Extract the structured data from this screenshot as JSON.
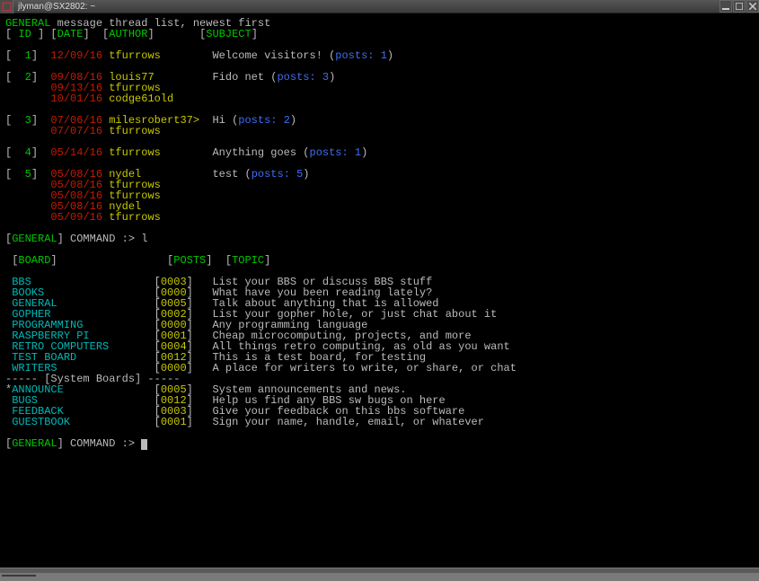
{
  "window": {
    "title": "jlyman@SX2802: ~"
  },
  "header": {
    "board": "GENERAL",
    "desc": "message thread list, newest first",
    "cols": {
      "id": "ID",
      "date": "DATE",
      "author": "AUTHOR",
      "subject": "SUBJECT"
    }
  },
  "threads": [
    {
      "id": "1",
      "rows": [
        {
          "date": "12/09/16",
          "author": "tfurrows"
        }
      ],
      "subject_pre": "Welcome visitors! (",
      "posts_label": "posts: 1",
      "subject_post": ")"
    },
    {
      "id": "2",
      "rows": [
        {
          "date": "09/08/16",
          "author": "louis77"
        },
        {
          "date": "09/13/16",
          "author": "tfurrows"
        },
        {
          "date": "10/01/16",
          "author": "codge61old"
        }
      ],
      "subject_pre": "Fido net (",
      "posts_label": "posts: 3",
      "subject_post": ")"
    },
    {
      "id": "3",
      "rows": [
        {
          "date": "07/06/16",
          "author": "milesrobert37>"
        },
        {
          "date": "07/07/16",
          "author": "tfurrows"
        }
      ],
      "subject_pre": "Hi (",
      "posts_label": "posts: 2",
      "subject_post": ")"
    },
    {
      "id": "4",
      "rows": [
        {
          "date": "05/14/16",
          "author": "tfurrows"
        }
      ],
      "subject_pre": "Anything goes (",
      "posts_label": "posts: 1",
      "subject_post": ")"
    },
    {
      "id": "5",
      "rows": [
        {
          "date": "05/08/16",
          "author": "nydel"
        },
        {
          "date": "05/08/16",
          "author": "tfurrows"
        },
        {
          "date": "05/08/16",
          "author": "tfurrows"
        },
        {
          "date": "05/08/16",
          "author": "nydel"
        },
        {
          "date": "05/09/16",
          "author": "tfurrows"
        }
      ],
      "subject_pre": "test (",
      "posts_label": "posts: 5",
      "subject_post": ")"
    }
  ],
  "prompt": {
    "board": "GENERAL",
    "label": "COMMAND :>",
    "entered": "l"
  },
  "board_hdr": {
    "board": "BOARD",
    "posts": "POSTS",
    "topic": "TOPIC"
  },
  "boards": [
    {
      "name": "BBS",
      "posts": "0003",
      "topic": "List your BBS or discuss BBS stuff",
      "star": false
    },
    {
      "name": "BOOKS",
      "posts": "0000",
      "topic": "What have you been reading lately?",
      "star": false
    },
    {
      "name": "GENERAL",
      "posts": "0005",
      "topic": "Talk about anything that is allowed",
      "star": false
    },
    {
      "name": "GOPHER",
      "posts": "0002",
      "topic": "List your gopher hole, or just chat about it",
      "star": false
    },
    {
      "name": "PROGRAMMING",
      "posts": "0000",
      "topic": "Any programming language",
      "star": false
    },
    {
      "name": "RASPBERRY PI",
      "posts": "0001",
      "topic": "Cheap microcomputing, projects, and more",
      "star": false
    },
    {
      "name": "RETRO COMPUTERS",
      "posts": "0004",
      "topic": "All things retro computing, as old as you want",
      "star": false
    },
    {
      "name": "TEST BOARD",
      "posts": "0012",
      "topic": "This is a test board, for testing",
      "star": false
    },
    {
      "name": "WRITERS",
      "posts": "0000",
      "topic": "A place for writers to write, or share, or chat",
      "star": false
    }
  ],
  "sys_div": "----- [System Boards] -----",
  "sys_boards": [
    {
      "name": "ANNOUNCE",
      "posts": "0005",
      "topic": "System announcements and news.",
      "star": true
    },
    {
      "name": "BUGS",
      "posts": "0012",
      "topic": "Help us find any BBS sw bugs on here",
      "star": false
    },
    {
      "name": "FEEDBACK",
      "posts": "0003",
      "topic": "Give your feedback on this bbs software",
      "star": false
    },
    {
      "name": "GUESTBOOK",
      "posts": "0001",
      "topic": "Sign your name, handle, email, or whatever",
      "star": false
    }
  ],
  "prompt2": {
    "board": "GENERAL",
    "label": "COMMAND :>"
  }
}
